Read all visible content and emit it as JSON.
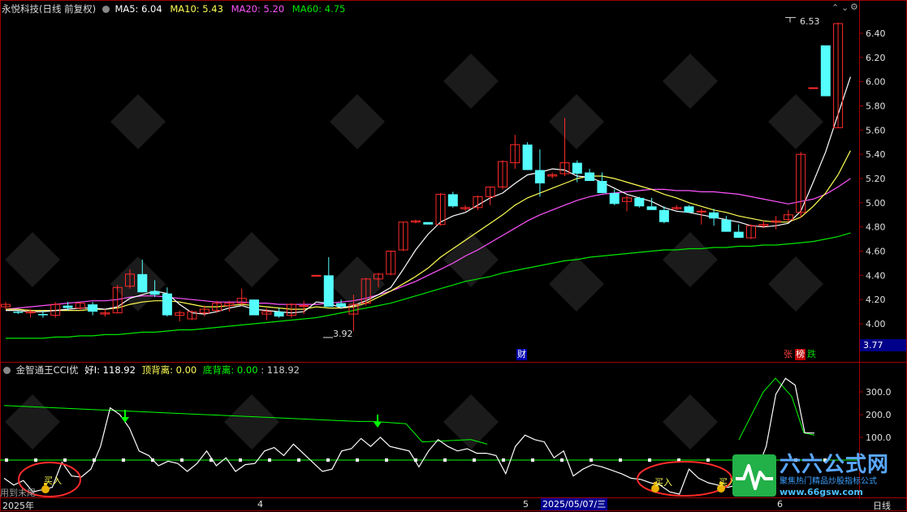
{
  "colors": {
    "up": "#ff2a2a",
    "down": "#54fcfc",
    "ma5": "#ffffff",
    "ma10": "#ffff54",
    "ma20": "#ff54ff",
    "ma60": "#00e600",
    "frame": "#a00000",
    "cci": "#ffffff",
    "green": "#00ff00",
    "text": "#cccccc",
    "yellow": "#ffff54"
  },
  "main_header": {
    "stock_title": "永悦科技(日线 前复权)",
    "ma5_label": "MA5: 6.04",
    "ma10_label": "MA10: 5.43",
    "ma20_label": "MA20: 5.20",
    "ma60_label": "MA60: 4.75",
    "toggle_icon": "triangle-down-icon"
  },
  "window_buttons": {
    "up_icon": "chevron-up-icon",
    "down_icon": "chevron-down-icon",
    "settings_icon": "gear-icon"
  },
  "sub_header": {
    "indicator_label": "金智通王CCI优",
    "hao_label": "好I: 118.92",
    "top_div_label": "顶背离: 0.00",
    "bottom_div_label": "底背离: 0.00",
    "last_value": ": 118.92"
  },
  "annotations": {
    "high_label": "6.53",
    "low_label": "3.92",
    "cai_badge": "财",
    "zhang_badge": "张",
    "bang_badge": "榜",
    "die_badge": "跌",
    "price_box": "3.77",
    "buy_label_1": "买入",
    "buy_label_2": "买入",
    "buy_label_3": "买入",
    "bottom_left_text": "用到末尾"
  },
  "x_axis": {
    "labels": [
      "2025年",
      "4",
      "5",
      "2025/05/07/三",
      "6"
    ],
    "period": "日线"
  },
  "watermark": {
    "brand": "六六公式网",
    "slogan": "聚焦热门精品炒股指标公式",
    "url": "www.66gsw.com"
  },
  "chart_data": [
    {
      "type": "candlestick",
      "title": "永悦科技(日线 前复权)",
      "y_axis_ticks": [
        6.4,
        6.2,
        6.0,
        5.8,
        5.6,
        5.4,
        5.2,
        5.0,
        4.8,
        4.6,
        4.4,
        4.2,
        4.0
      ],
      "ylim": [
        3.86,
        6.53
      ],
      "candles": [
        [
          4.14,
          4.18,
          4.12,
          4.16
        ],
        [
          4.1,
          4.11,
          4.08,
          4.09
        ],
        [
          4.09,
          4.12,
          4.05,
          4.1
        ],
        [
          4.08,
          4.11,
          4.05,
          4.07
        ],
        [
          4.07,
          4.18,
          4.05,
          4.16
        ],
        [
          4.15,
          4.18,
          4.11,
          4.13
        ],
        [
          4.13,
          4.18,
          4.11,
          4.17
        ],
        [
          4.16,
          4.18,
          4.07,
          4.1
        ],
        [
          4.08,
          4.12,
          4.06,
          4.09
        ],
        [
          4.09,
          4.32,
          4.09,
          4.3
        ],
        [
          4.31,
          4.45,
          4.29,
          4.41
        ],
        [
          4.41,
          4.53,
          4.26,
          4.26
        ],
        [
          4.27,
          4.36,
          4.22,
          4.24
        ],
        [
          4.25,
          4.3,
          4.06,
          4.07
        ],
        [
          4.07,
          4.11,
          4.02,
          4.09
        ],
        [
          4.04,
          4.11,
          4.03,
          4.1
        ],
        [
          4.09,
          4.15,
          4.06,
          4.12
        ],
        [
          4.11,
          4.19,
          4.09,
          4.17
        ],
        [
          4.15,
          4.19,
          4.1,
          4.17
        ],
        [
          4.17,
          4.29,
          4.15,
          4.21
        ],
        [
          4.2,
          4.2,
          4.07,
          4.07
        ],
        [
          4.08,
          4.13,
          4.03,
          4.1
        ],
        [
          4.1,
          4.13,
          4.05,
          4.06
        ],
        [
          4.07,
          4.17,
          4.05,
          4.16
        ],
        [
          4.15,
          4.19,
          4.08,
          4.15
        ],
        [
          4.4,
          4.4,
          4.4,
          4.4
        ],
        [
          4.4,
          4.55,
          4.14,
          4.14
        ],
        [
          4.17,
          4.2,
          4.13,
          4.14
        ],
        [
          4.08,
          4.24,
          3.94,
          4.16
        ],
        [
          4.17,
          4.38,
          4.15,
          4.37
        ],
        [
          4.37,
          4.42,
          4.3,
          4.41
        ],
        [
          4.41,
          4.6,
          4.4,
          4.6
        ],
        [
          4.61,
          4.84,
          4.6,
          4.84
        ],
        [
          4.84,
          4.86,
          4.83,
          4.85
        ],
        [
          4.84,
          4.84,
          4.82,
          4.82
        ],
        [
          4.82,
          5.08,
          4.81,
          5.07
        ],
        [
          5.07,
          5.09,
          4.96,
          4.97
        ],
        [
          4.95,
          4.98,
          4.93,
          4.96
        ],
        [
          4.96,
          5.06,
          4.94,
          5.05
        ],
        [
          5.05,
          5.13,
          4.98,
          5.13
        ],
        [
          5.13,
          5.35,
          5.11,
          5.34
        ],
        [
          5.33,
          5.56,
          5.28,
          5.48
        ],
        [
          5.48,
          5.5,
          5.27,
          5.27
        ],
        [
          5.27,
          5.44,
          5.05,
          5.16
        ],
        [
          5.22,
          5.25,
          5.2,
          5.23
        ],
        [
          5.24,
          5.7,
          5.22,
          5.33
        ],
        [
          5.33,
          5.35,
          5.17,
          5.24
        ],
        [
          5.25,
          5.28,
          5.18,
          5.18
        ],
        [
          5.18,
          5.25,
          5.08,
          5.08
        ],
        [
          5.08,
          5.11,
          4.98,
          4.99
        ],
        [
          5.01,
          5.06,
          4.93,
          5.04
        ],
        [
          5.04,
          5.05,
          4.96,
          4.97
        ],
        [
          4.97,
          5.04,
          4.94,
          4.94
        ],
        [
          4.94,
          4.97,
          4.83,
          4.84
        ],
        [
          4.95,
          4.98,
          4.94,
          4.96
        ],
        [
          4.97,
          4.98,
          4.92,
          4.92
        ],
        [
          4.93,
          4.95,
          4.82,
          4.93
        ],
        [
          4.92,
          4.95,
          4.81,
          4.87
        ],
        [
          4.86,
          4.89,
          4.76,
          4.76
        ],
        [
          4.76,
          4.82,
          4.71,
          4.71
        ],
        [
          4.71,
          4.82,
          4.7,
          4.81
        ],
        [
          4.81,
          4.85,
          4.79,
          4.82
        ],
        [
          4.84,
          4.89,
          4.78,
          4.85
        ],
        [
          4.86,
          4.94,
          4.84,
          4.9
        ],
        [
          4.92,
          5.42,
          4.88,
          5.4
        ],
        [
          5.95,
          5.95,
          5.94,
          5.95
        ],
        [
          6.3,
          6.3,
          5.88,
          5.88
        ],
        [
          5.62,
          6.49,
          5.62,
          6.48
        ]
      ],
      "ma5": [
        4.11,
        4.11,
        4.1,
        4.1,
        4.11,
        4.12,
        4.13,
        4.13,
        4.12,
        4.14,
        4.21,
        4.24,
        4.27,
        4.25,
        4.16,
        4.09,
        4.08,
        4.1,
        4.13,
        4.15,
        4.12,
        4.11,
        4.1,
        4.09,
        4.1,
        4.18,
        4.17,
        4.13,
        4.15,
        4.19,
        4.24,
        4.3,
        4.45,
        4.61,
        4.74,
        4.84,
        4.89,
        4.92,
        4.98,
        5.04,
        5.08,
        5.16,
        5.23,
        5.25,
        5.28,
        5.27,
        5.22,
        5.21,
        5.17,
        5.12,
        5.07,
        5.04,
        5.01,
        4.96,
        4.93,
        4.92,
        4.9,
        4.88,
        4.86,
        4.84,
        4.81,
        4.8,
        4.81,
        4.83,
        4.93,
        5.17,
        5.42,
        5.73,
        6.04
      ],
      "ma10": [
        4.12,
        4.12,
        4.11,
        4.11,
        4.11,
        4.11,
        4.11,
        4.12,
        4.12,
        4.13,
        4.16,
        4.18,
        4.19,
        4.19,
        4.18,
        4.16,
        4.14,
        4.14,
        4.15,
        4.16,
        4.15,
        4.14,
        4.13,
        4.12,
        4.12,
        4.14,
        4.13,
        4.13,
        4.14,
        4.17,
        4.22,
        4.27,
        4.33,
        4.39,
        4.46,
        4.55,
        4.62,
        4.69,
        4.76,
        4.83,
        4.9,
        4.98,
        5.04,
        5.08,
        5.12,
        5.16,
        5.2,
        5.22,
        5.22,
        5.2,
        5.17,
        5.14,
        5.11,
        5.07,
        5.04,
        5.0,
        4.97,
        4.94,
        4.92,
        4.89,
        4.87,
        4.85,
        4.84,
        4.84,
        4.88,
        4.97,
        5.08,
        5.23,
        5.43
      ],
      "ma20": [
        4.12,
        4.13,
        4.14,
        4.15,
        4.16,
        4.17,
        4.18,
        4.19,
        4.19,
        4.2,
        4.22,
        4.23,
        4.23,
        4.22,
        4.21,
        4.2,
        4.19,
        4.18,
        4.18,
        4.18,
        4.17,
        4.17,
        4.16,
        4.16,
        4.16,
        4.16,
        4.17,
        4.18,
        4.19,
        4.21,
        4.24,
        4.27,
        4.31,
        4.35,
        4.4,
        4.45,
        4.5,
        4.56,
        4.61,
        4.67,
        4.73,
        4.79,
        4.85,
        4.9,
        4.94,
        4.98,
        5.02,
        5.05,
        5.07,
        5.08,
        5.09,
        5.1,
        5.11,
        5.11,
        5.1,
        5.1,
        5.09,
        5.09,
        5.08,
        5.07,
        5.05,
        5.03,
        5.01,
        4.99,
        5.01,
        5.03,
        5.07,
        5.13,
        5.2
      ],
      "ma60": [
        3.88,
        3.88,
        3.88,
        3.88,
        3.89,
        3.89,
        3.9,
        3.9,
        3.91,
        3.91,
        3.92,
        3.93,
        3.93,
        3.94,
        3.95,
        3.95,
        3.96,
        3.97,
        3.98,
        3.99,
        4.0,
        4.01,
        4.02,
        4.03,
        4.04,
        4.05,
        4.07,
        4.09,
        4.11,
        4.13,
        4.15,
        4.17,
        4.2,
        4.23,
        4.26,
        4.29,
        4.32,
        4.35,
        4.37,
        4.39,
        4.42,
        4.44,
        4.46,
        4.48,
        4.5,
        4.52,
        4.53,
        4.55,
        4.56,
        4.57,
        4.58,
        4.59,
        4.6,
        4.61,
        4.61,
        4.62,
        4.62,
        4.63,
        4.63,
        4.64,
        4.64,
        4.65,
        4.65,
        4.66,
        4.67,
        4.68,
        4.7,
        4.72,
        4.75
      ]
    },
    {
      "type": "line",
      "title": "金智通王CCI优",
      "y_axis_ticks": [
        300,
        200,
        100
      ],
      "ylim": [
        -160,
        400
      ],
      "zero_level": 0,
      "series": [
        {
          "name": "好I",
          "values": [
            -80,
            -110,
            -90,
            -140,
            -130,
            -120,
            -10,
            -70,
            -75,
            -40,
            60,
            230,
            200,
            140,
            40,
            20,
            -25,
            -5,
            -15,
            -50,
            -15,
            40,
            -25,
            10,
            -50,
            -20,
            -15,
            40,
            55,
            20,
            70,
            30,
            -10,
            -50,
            -40,
            40,
            50,
            95,
            60,
            100,
            60,
            50,
            40,
            -30,
            40,
            90,
            60,
            40,
            50,
            30,
            30,
            20,
            -60,
            60,
            110,
            90,
            80,
            10,
            40,
            -70,
            -40,
            -20,
            -30,
            -45,
            -60,
            -80,
            -85,
            -100,
            -110,
            -140,
            -150,
            -40,
            -80,
            -100,
            -110,
            -120,
            -110,
            -100,
            -50,
            60,
            290,
            360,
            330,
            120,
            118.92
          ]
        },
        {
          "name": "顶背离",
          "values": [
            240,
            170
          ]
        },
        {
          "name": "底背离",
          "values": [
            180,
            90
          ]
        }
      ]
    }
  ]
}
